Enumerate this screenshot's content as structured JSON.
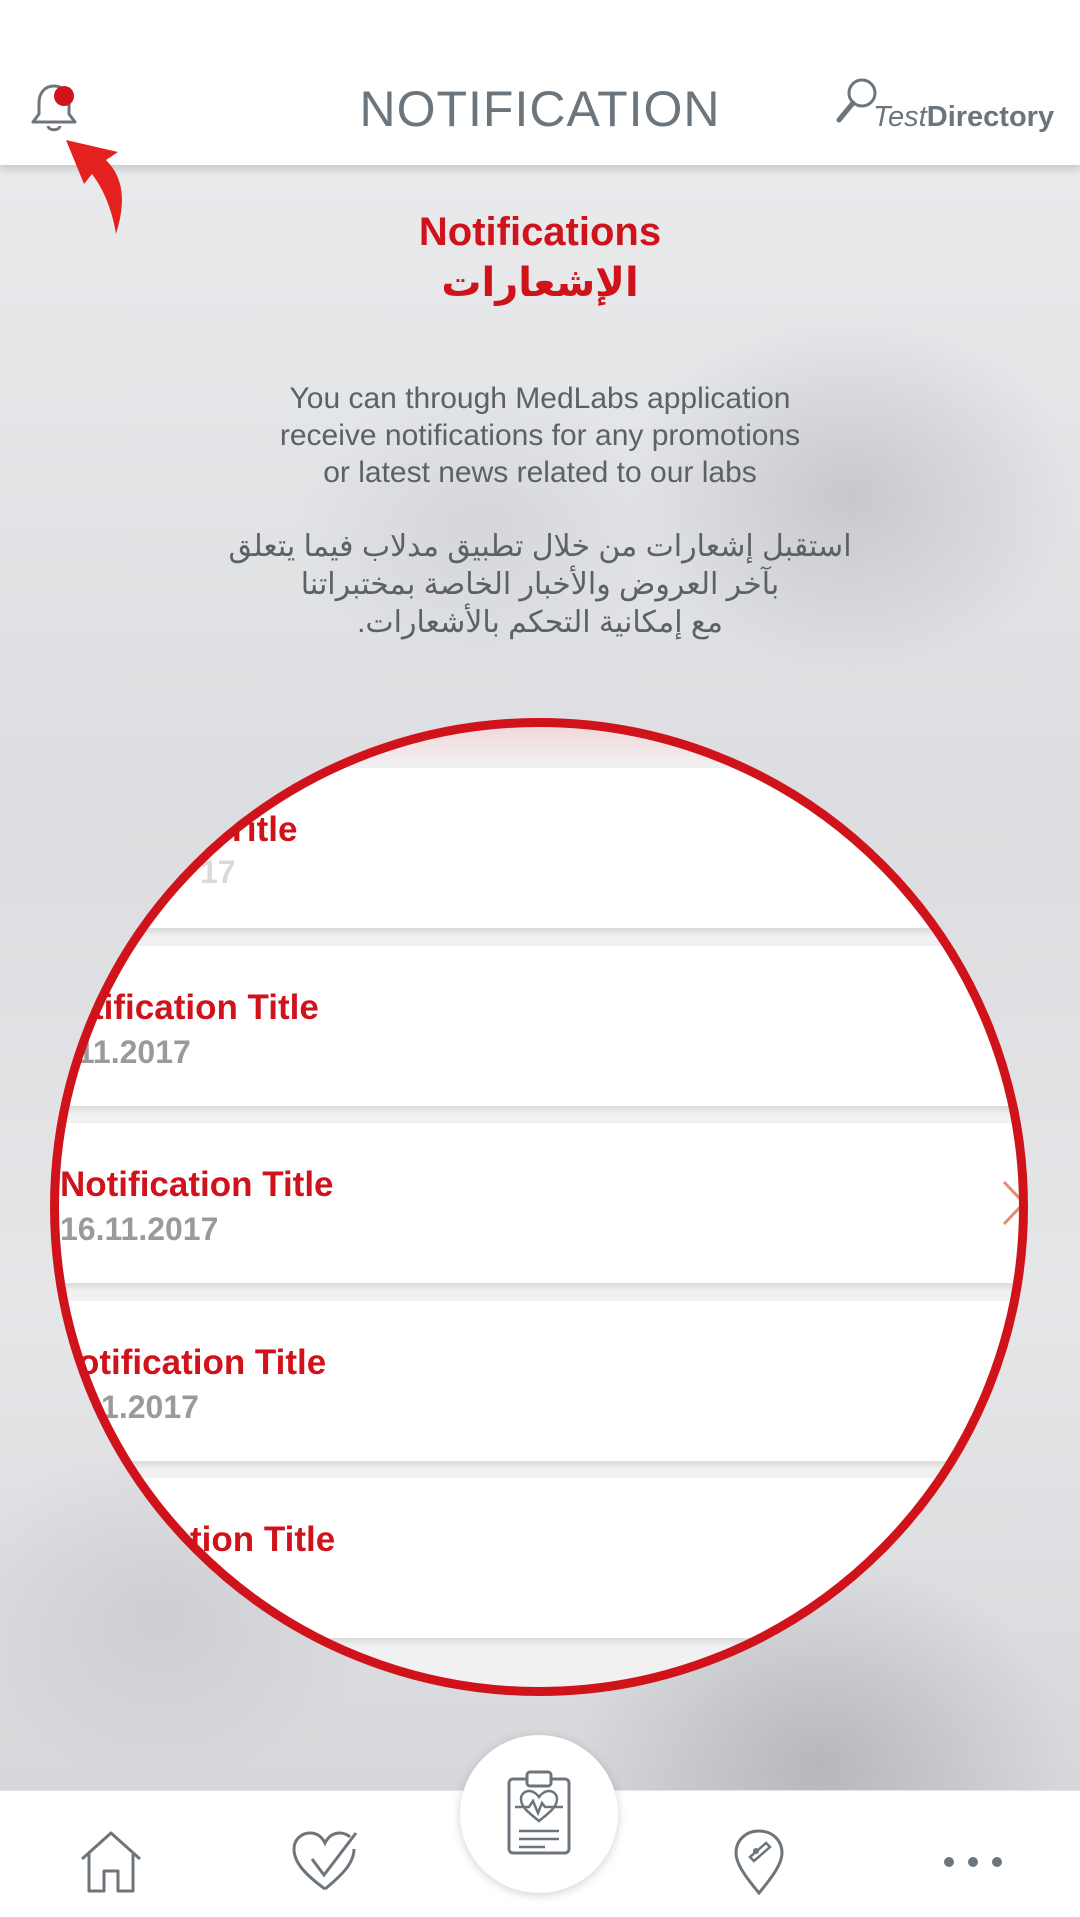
{
  "header": {
    "title": "NOTIFICATION",
    "test_directory_prefix": "Test",
    "test_directory_suffix": "Directory"
  },
  "intro": {
    "title_en": "Notifications",
    "title_ar": "الإشعارات",
    "description_en": [
      "You can through MedLabs application",
      "receive notifications for any promotions",
      "or latest news related to our labs"
    ],
    "description_ar": [
      "استقبل إشعارات من خلال تطبيق مدلاب فيما يتعلق",
      "بآخر العروض والأخبار الخاصة بمختبراتنا",
      "مع إمكانية التحكم بالأشعارات."
    ]
  },
  "notifications": [
    {
      "title": "n Title",
      "date": "17"
    },
    {
      "title": "tification Title",
      "date": ".11.2017"
    },
    {
      "title": "Notification Title",
      "date": "16.11.2017"
    },
    {
      "title": "otification Title",
      "date": "11.2017"
    },
    {
      "title": "tion Title",
      "date": ""
    }
  ],
  "icons": {
    "bell": "bell-icon",
    "search": "search-icon",
    "pointer_arrow": "arrow-icon",
    "home": "home-icon",
    "heart_check": "heart-check-icon",
    "clipboard": "clipboard-heart-icon",
    "location": "location-pin-icon",
    "more": "more-dots-icon"
  },
  "colors": {
    "accent_red": "#d0121b",
    "header_text": "#6d757c",
    "body_text": "#5b6168"
  }
}
